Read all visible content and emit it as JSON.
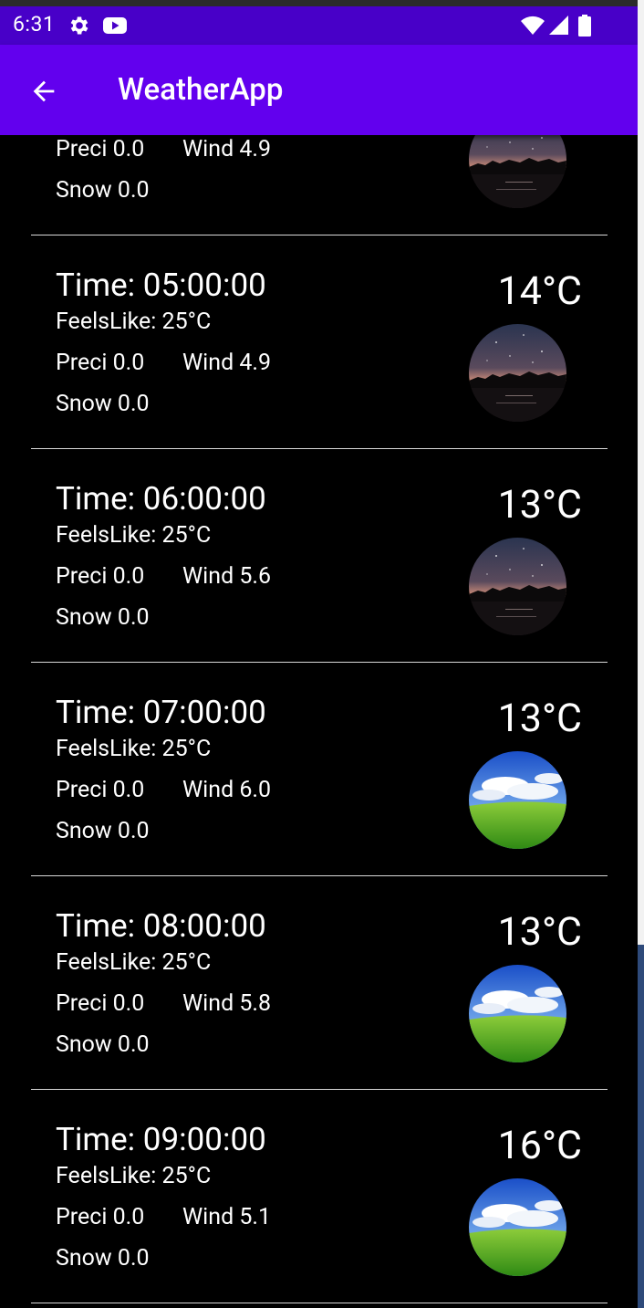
{
  "status_bar": {
    "time": "6:31",
    "icons": [
      "gear-icon",
      "youtube-icon",
      "wifi-icon",
      "signal-icon",
      "battery-icon"
    ]
  },
  "app_bar": {
    "title": "WeatherApp",
    "back_icon": "arrow-back-icon"
  },
  "rows": [
    {
      "time": "",
      "feels": "",
      "preci": "Preci 0.0",
      "wind": "Wind 4.9",
      "snow": "Snow 0.0",
      "temp": "",
      "icon": "night-sky"
    },
    {
      "time": "Time: 05:00:00",
      "feels": "FeelsLike: 25°C",
      "preci": "Preci 0.0",
      "wind": "Wind 4.9",
      "snow": "Snow 0.0",
      "temp": "14°C",
      "icon": "night-sky"
    },
    {
      "time": "Time: 06:00:00",
      "feels": "FeelsLike: 25°C",
      "preci": "Preci 0.0",
      "wind": "Wind 5.6",
      "snow": "Snow 0.0",
      "temp": "13°C",
      "icon": "night-sky"
    },
    {
      "time": "Time: 07:00:00",
      "feels": "FeelsLike: 25°C",
      "preci": "Preci 0.0",
      "wind": "Wind 6.0",
      "snow": "Snow 0.0",
      "temp": "13°C",
      "icon": "day-sky"
    },
    {
      "time": "Time: 08:00:00",
      "feels": "FeelsLike: 25°C",
      "preci": "Preci 0.0",
      "wind": "Wind 5.8",
      "snow": "Snow 0.0",
      "temp": "13°C",
      "icon": "day-sky"
    },
    {
      "time": "Time: 09:00:00",
      "feels": "FeelsLike: 25°C",
      "preci": "Preci 0.0",
      "wind": "Wind 5.1",
      "snow": "Snow 0.0",
      "temp": "16°C",
      "icon": "day-sky"
    }
  ],
  "colors": {
    "status_bar": "#4800c8",
    "app_bar": "#6200ee",
    "background": "#000000",
    "divider": "#d9d9d9",
    "text": "#ffffff"
  }
}
